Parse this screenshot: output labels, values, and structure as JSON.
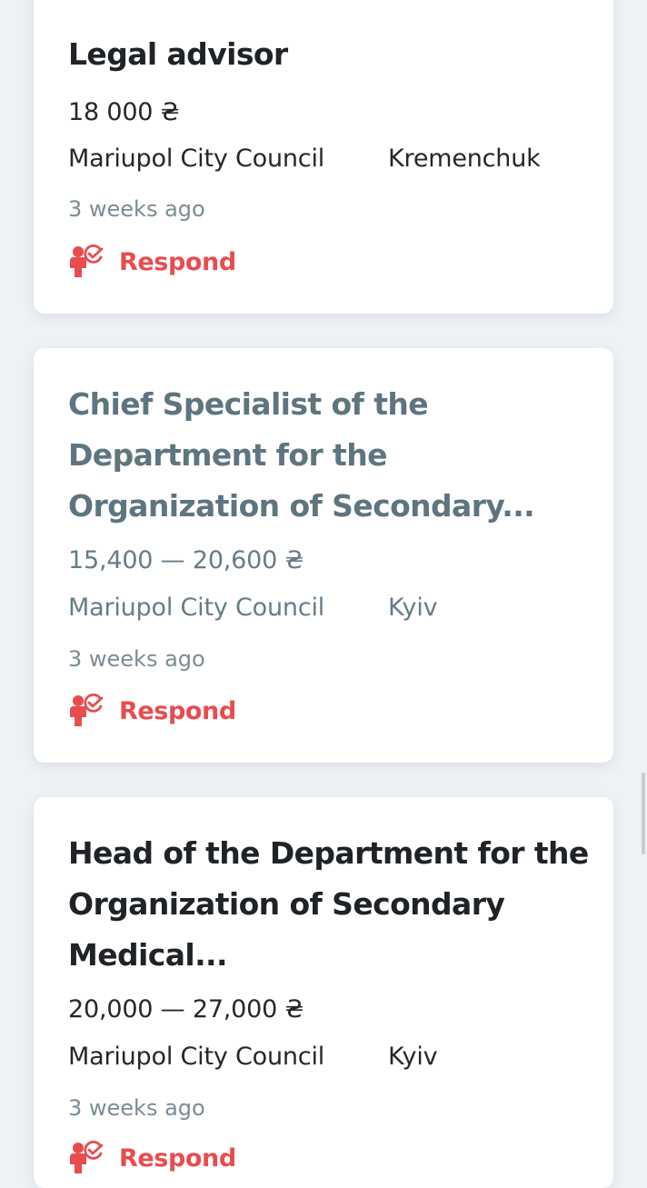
{
  "colors": {
    "page_background": "#eef2f5",
    "card_background": "#ffffff",
    "accent_red": "#e84c4f",
    "visited_title": "#5e7580",
    "text_dark": "#1f2327",
    "text_muted": "#7c8c94"
  },
  "jobs": [
    {
      "title": "Legal advisor",
      "salary": "18 000 ₴",
      "employer": "Mariupol City Council",
      "city": "Kremenchuk",
      "posted": "3 weeks ago",
      "respond_label": "Respond",
      "respond_icon": "person-check-icon",
      "visited": false
    },
    {
      "title": "Chief Specialist of the Department for the Organization of Secondary...",
      "salary": "15,400 — 20,600 ₴",
      "employer": "Mariupol City Council",
      "city": "Kyiv",
      "posted": "3 weeks ago",
      "respond_label": "Respond",
      "respond_icon": "person-check-icon",
      "visited": true
    },
    {
      "title": "Head of the Department for the Organization of Secondary Medical...",
      "salary": "20,000 — 27,000 ₴",
      "employer": "Mariupol City Council",
      "city": "Kyiv",
      "posted": "3 weeks ago",
      "respond_label": "Respond",
      "respond_icon": "person-check-icon",
      "visited": false
    }
  ]
}
